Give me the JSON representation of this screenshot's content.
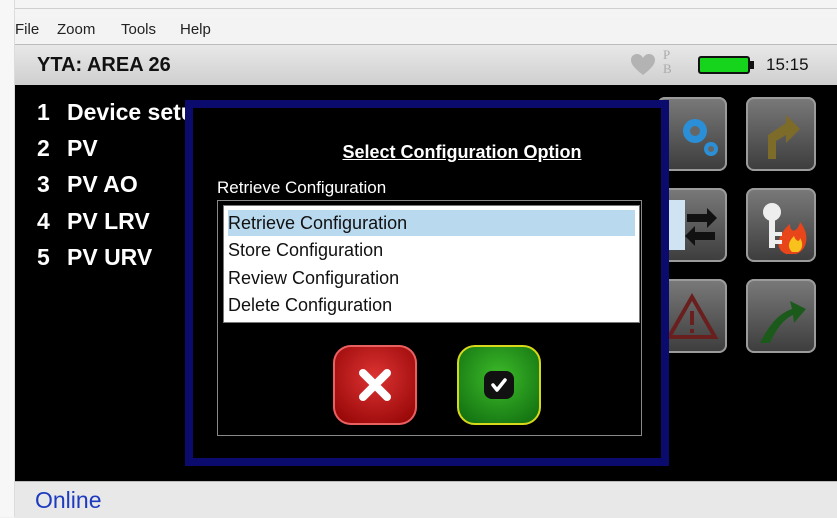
{
  "menu": {
    "file": "File",
    "zoom": "Zoom",
    "tools": "Tools",
    "help": "Help"
  },
  "header": {
    "title": "YTA: AREA 26",
    "pb_top": "P",
    "pb_bottom": "B",
    "time": "15:15"
  },
  "device_menu": [
    {
      "num": "1",
      "label": "Device setup"
    },
    {
      "num": "2",
      "label": "PV"
    },
    {
      "num": "3",
      "label": "PV AO"
    },
    {
      "num": "4",
      "label": "PV LRV"
    },
    {
      "num": "5",
      "label": "PV URV"
    }
  ],
  "dialog": {
    "title": "Select Configuration Option",
    "current": "Retrieve Configuration",
    "options": [
      "Retrieve Configuration",
      "Store Configuration",
      "Review Configuration",
      "Delete Configuration"
    ],
    "selected_index": 0
  },
  "status": {
    "text": "Online"
  },
  "colors": {
    "accent_blue": "#1d3bbf",
    "dialog_border": "#0b0b6e",
    "battery": "#16d31c",
    "selection": "#b9d9ef"
  },
  "icons": [
    "gears-icon",
    "turn-arrow-icon",
    "transfer-icon",
    "key-flame-icon",
    "warning-icon",
    "up-arrow-icon",
    "heart-icon",
    "battery-icon",
    "cancel-x-icon",
    "checkmark-icon"
  ]
}
